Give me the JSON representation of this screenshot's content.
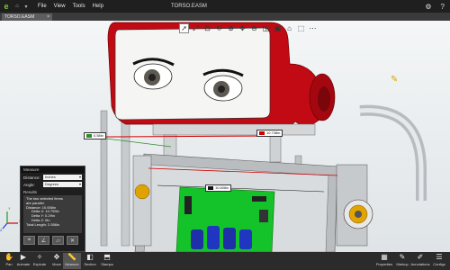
{
  "app": {
    "menu": [
      "File",
      "View",
      "Tools",
      "Help"
    ],
    "document_title": "TORSO.EASM",
    "tab": "TORSO.EASM"
  },
  "viewport": {
    "measurements": [
      {
        "id": "m1",
        "value": "0.58in",
        "color": "#2e8b2e"
      },
      {
        "id": "m2",
        "value": "10.738in",
        "color": "#d00000"
      },
      {
        "id": "m3",
        "value": "10.606in",
        "color": "#111111"
      }
    ],
    "axis_labels": [
      "X",
      "Y",
      "Z"
    ]
  },
  "measure_panel": {
    "title": "Measure",
    "distance_label": "Distance:",
    "distance_value": "Inches",
    "angle_label": "Angle:",
    "angle_value": "Degrees",
    "results_label": "Results",
    "results_lines": [
      "The two selected items",
      "are parallel.",
      "Distance: 10.606in",
      "Delta X: 10.799in",
      "Delta Y: 0.29in",
      "Delta Z: 0in",
      "Total Length: 2.556in"
    ]
  },
  "bottom_bar": {
    "left": [
      "Pan",
      "Animate",
      "Explode",
      "Move",
      "Measure",
      "Section",
      "Stamps"
    ],
    "right": [
      "Properties",
      "Markup",
      "Annotations",
      "Configs"
    ]
  }
}
